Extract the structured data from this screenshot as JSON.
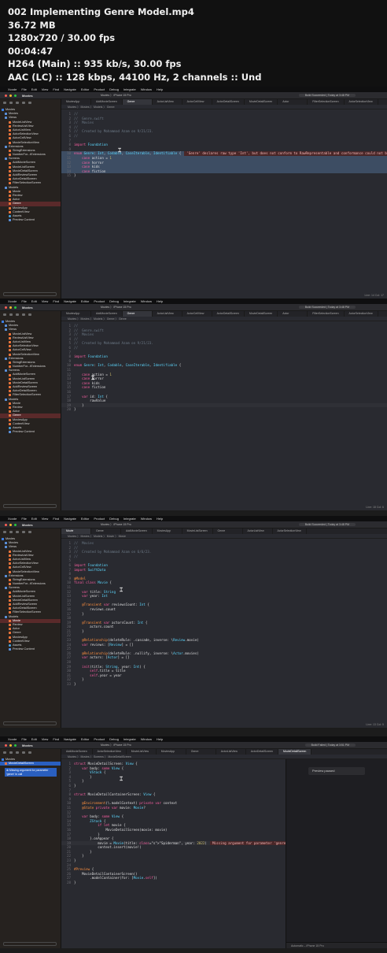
{
  "header": {
    "filename": "002 Implementing Genre Model.mp4",
    "size": "36.72 MB",
    "resolution": "1280x720 / 30.00 fps",
    "duration": "00:04:47",
    "video": "H264 (Main) :: 935 kb/s, 30.00 fps",
    "audio": "AAC (LC) :: 128 kbps, 44100 Hz, 2 channels :: Und"
  },
  "menu": [
    "Xcode",
    "File",
    "Edit",
    "View",
    "Find",
    "Navigate",
    "Editor",
    "Product",
    "Debug",
    "Integrate",
    "Window",
    "Help"
  ],
  "project": "Movies",
  "frames": [
    {
      "scheme": "Movies 〉 iPhone 15 Pro",
      "status": "Build Succeeded | Today at 3:48 PM",
      "tabs": [
        "MoviesApp",
        "AddMovieScreen",
        "Genre",
        "ActorListView",
        "ActorCellView",
        "ActorDetailScreen",
        "MovieDetailScreen",
        "Actor",
        "FilterSelectionScreen",
        "ActorSelectionView"
      ],
      "active_tab": 2,
      "breadcrumb": "Movies 〉 Movies 〉 Models 〉 Genre",
      "sidebar": [
        "Movies",
        "Movies",
        "Views",
        "MovieListView",
        "ReviewListView",
        "ActorListView",
        "ActorSelectionView",
        "ActorCellView",
        "MovieSelectionView",
        "Extensions",
        "StringExtensions",
        "NumberFor...tExtensions",
        "Screens",
        "AddMovieScreen",
        "MovieListScreen",
        "MovieDetailScreen",
        "AddReviewScreen",
        "ActorDetailScreen",
        "FilterSelectionScreen",
        "Models",
        "Movie",
        "Review",
        "Actor",
        "Genre",
        "MoviesApp",
        "ContentView",
        "Assets",
        "Preview Content"
      ],
      "selected": 23,
      "code": [
        "//",
        "//  Genre.swift",
        "//  Movies",
        "//",
        "//  Created by Mohammad Azam on 9/21/23.",
        "//",
        "",
        "import Foundation",
        "",
        "enum Genre: Int, Codable, CaseIterable, Identifiable {",
        "    case action = 1",
        "    case horror",
        "    case kids",
        "    case fiction",
        "}"
      ],
      "error": "'Genre' declares raw type 'Int', but does not conform to RawRepresentable and conformance could not be synt...",
      "line_info": "Line: 14 Col: 17"
    },
    {
      "scheme": "Movies 〉 iPhone 15 Pro",
      "status": "Build Succeeded | Today at 3:48 PM",
      "tabs": [
        "MoviesApp",
        "AddMovieScreen",
        "Genre",
        "ActorListView",
        "ActorCellView",
        "ActorDetailScreen",
        "MovieDetailScreen",
        "Actor",
        "FilterSelectionScreen",
        "ActorSelectionView"
      ],
      "active_tab": 2,
      "breadcrumb": "Movies 〉 Movies 〉 Models 〉 Genre 〉 Genre",
      "sidebar": [
        "Movies",
        "Movies",
        "Views",
        "MovieListView",
        "ReviewListView",
        "ActorListView",
        "ActorSelectionView",
        "ActorCellView",
        "MovieSelectionView",
        "Extensions",
        "StringExtensions",
        "NumberFor...tExtensions",
        "Screens",
        "AddMovieScreen",
        "MovieListScreen",
        "MovieDetailScreen",
        "AddReviewScreen",
        "ActorDetailScreen",
        "FilterSelectionScreen",
        "Models",
        "Movie",
        "Review",
        "Actor",
        "Genre",
        "MoviesApp",
        "ContentView",
        "Assets",
        "Preview Content"
      ],
      "selected": 23,
      "code": [
        "//",
        "//  Genre.swift",
        "//  Movies",
        "//",
        "//  Created by Mohammad Azam on 9/21/23.",
        "//",
        "",
        "import Foundation",
        "",
        "enum Genre: Int, Codable, CaseIterable, Identifiable {",
        "",
        "    case action = 1",
        "    case horror",
        "    case kids",
        "    case fiction",
        "",
        "    var id: Int {",
        "        rawValue",
        "    }",
        "}"
      ],
      "line_info": "Line: 18 Col: 6"
    },
    {
      "scheme": "Movies 〉 iPhone 15 Pro",
      "status": "Build Succeeded | Today at 3:48 PM",
      "tabs": [
        "Movie",
        "Genre",
        "AddMovieScreen",
        "MoviesApp",
        "MovieListScreen",
        "Genre",
        "ActorListView",
        "ActorSelectionView"
      ],
      "active_tab": 0,
      "breadcrumb": "Movies 〉 Movies 〉 Models 〉 Movie 〉 Movie",
      "sidebar": [
        "Movies",
        "Movies",
        "Views",
        "MovieListView",
        "ReviewListView",
        "ActorListView",
        "ActorSelectionView",
        "ActorCellView",
        "MovieSelectionView",
        "Extensions",
        "StringExtensions",
        "NumberFor...tExtensions",
        "Screens",
        "AddMovieScreen",
        "MovieListScreen",
        "MovieDetailScreen",
        "AddReviewScreen",
        "ActorDetailScreen",
        "FilterSelectionScreen",
        "Models",
        "Movie",
        "Review",
        "Actor",
        "Genre",
        "MoviesApp",
        "ContentView",
        "Assets",
        "Preview Content"
      ],
      "selected": 20,
      "code": [
        "//  Movies",
        "//",
        "//  Created by Mohammad Azam on 6/6/23.",
        "//",
        "",
        "import Foundation",
        "import SwiftData",
        "",
        "@Model",
        "final class Movie {",
        "",
        "    var title: String",
        "    var year: Int",
        "",
        "    @Transient var reviewsCount: Int {",
        "        reviews.count",
        "    }",
        "",
        "    @Transient var actorsCount: Int {",
        "        actors.count",
        "    }",
        "",
        "    @Relationship(deleteRule: .cascade, inverse: \\Review.movie)",
        "    var reviews: [Review] = []",
        "",
        "    @Relationship(deleteRule: .nullify, inverse: \\Actor.movies)",
        "    var actors: [Actor] = []",
        "",
        "    init(title: String, year: Int) {",
        "        self.title = title",
        "        self.year = year",
        "    }",
        "}"
      ],
      "line_info": "Line: 13 Col: 5"
    },
    {
      "scheme": "Movies 〉 iPhone 15 Pro",
      "status": "Build Failed | Today at 3:51 PM",
      "tabs": [
        "AddMovieScreen",
        "ActorSelectionView",
        "MovieListView",
        "MoviesApp",
        "Genre",
        "ActorListView",
        "ActorDetailScreen",
        "MovieDetailScreen"
      ],
      "active_tab": 7,
      "breadcrumb": "Movies 〉 Movies 〉 Screens 〉 MovieDetailScreen",
      "sidebar": [
        "Movies",
        "MovieDetailScreen"
      ],
      "selected": 1,
      "issue": "Missing argument for parameter 'genre' in call",
      "code": [
        "struct MovieDetailScreen: View {",
        "    var body: some View {",
        "        VStack {",
        "        }",
        "    }",
        "}",
        "",
        "struct MovieDetailContainerScreen: View {",
        "",
        "    @Environment(\\.modelContext) private var context",
        "    @State private var movie: Movie?",
        "",
        "    var body: some View {",
        "        ZStack {",
        "            if let movie {",
        "                MovieDetailScreen(movie: movie)",
        "            }",
        "        }.onAppear {",
        "            movie = Movie(title: \"Spiderman\", year: 2022)",
        "            context.insert(movie!)",
        "        }",
        "    }",
        "}",
        "",
        "#Preview {",
        "    MovieDetailContainerScreen()",
        "        .modelContainer(for: [Movie.self])",
        "}"
      ],
      "error": "Missing argument for parameter 'genre'...",
      "preview_card": "Preview paused",
      "preview_device": "Automatic – iPhone 15 Pro",
      "line_info": "Line: 34 Col: 52"
    }
  ]
}
